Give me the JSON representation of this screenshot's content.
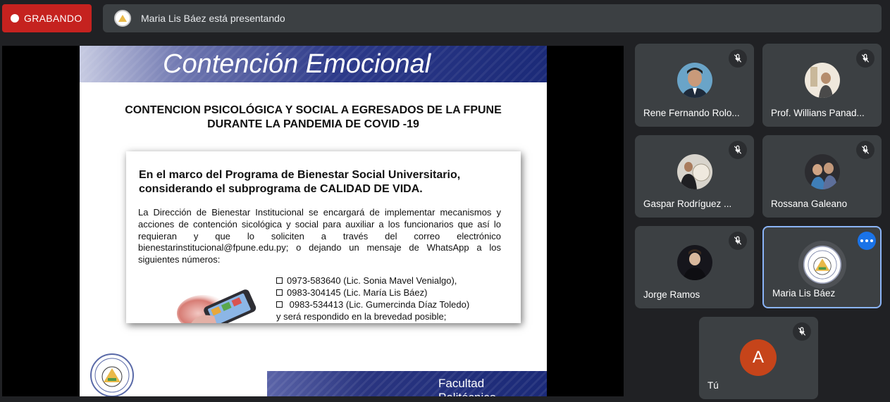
{
  "recording": {
    "label": "GRABANDO"
  },
  "presenter_bar": {
    "text": "Maria Lis Báez está presentando"
  },
  "slide": {
    "title": "Contención Emocional",
    "subtitle_line1": "CONTENCION PSICOLÓGICA Y SOCIAL A EGRESADOS DE LA FPUNE",
    "subtitle_line2": "DURANTE LA PANDEMIA DE COVID -19",
    "card_heading_line1": "En el marco del Programa de Bienestar Social Universitario,",
    "card_heading_line2": "considerando el subprograma  de CALIDAD DE VIDA.",
    "card_body": "La Dirección de Bienestar Institucional se encargará de implementar mecanismos y acciones de contención sicológica y social para auxiliar a los funcionarios que así lo requieran y que lo soliciten a través del correo electrónico bienestarinstitucional@fpune.edu.py; o dejando un mensaje de WhatsApp a los siguientes números:",
    "contacts": [
      "0973-583640 (Lic. Sonia Mavel Venialgo),",
      "0983-304145 (Lic. María Lis Báez)",
      " 0983-534413 (Lic. Gumercinda Díaz Toledo)"
    ],
    "closing": "y será respondido en la brevedad posible;",
    "footer_line1": "Facultad",
    "footer_line2": "Politécnica"
  },
  "participants": [
    {
      "name": "Rene Fernando Rolo...",
      "muted": true,
      "avatar": "photo"
    },
    {
      "name": "Prof. Willians Panad...",
      "muted": true,
      "avatar": "photo"
    },
    {
      "name": "Gaspar Rodríguez ...",
      "muted": true,
      "avatar": "photo"
    },
    {
      "name": "Rossana Galeano",
      "muted": true,
      "avatar": "photo"
    },
    {
      "name": "Jorge Ramos",
      "muted": true,
      "avatar": "photo"
    },
    {
      "name": "Maria Lis Báez",
      "muted": false,
      "avatar": "seal",
      "active": true
    },
    {
      "name": "Tú",
      "muted": true,
      "avatar_letter": "A"
    }
  ],
  "colors": {
    "record": "#c5221f",
    "tile": "#3c4043",
    "active_border": "#8ab4f8",
    "self_avatar": "#c6441a"
  }
}
